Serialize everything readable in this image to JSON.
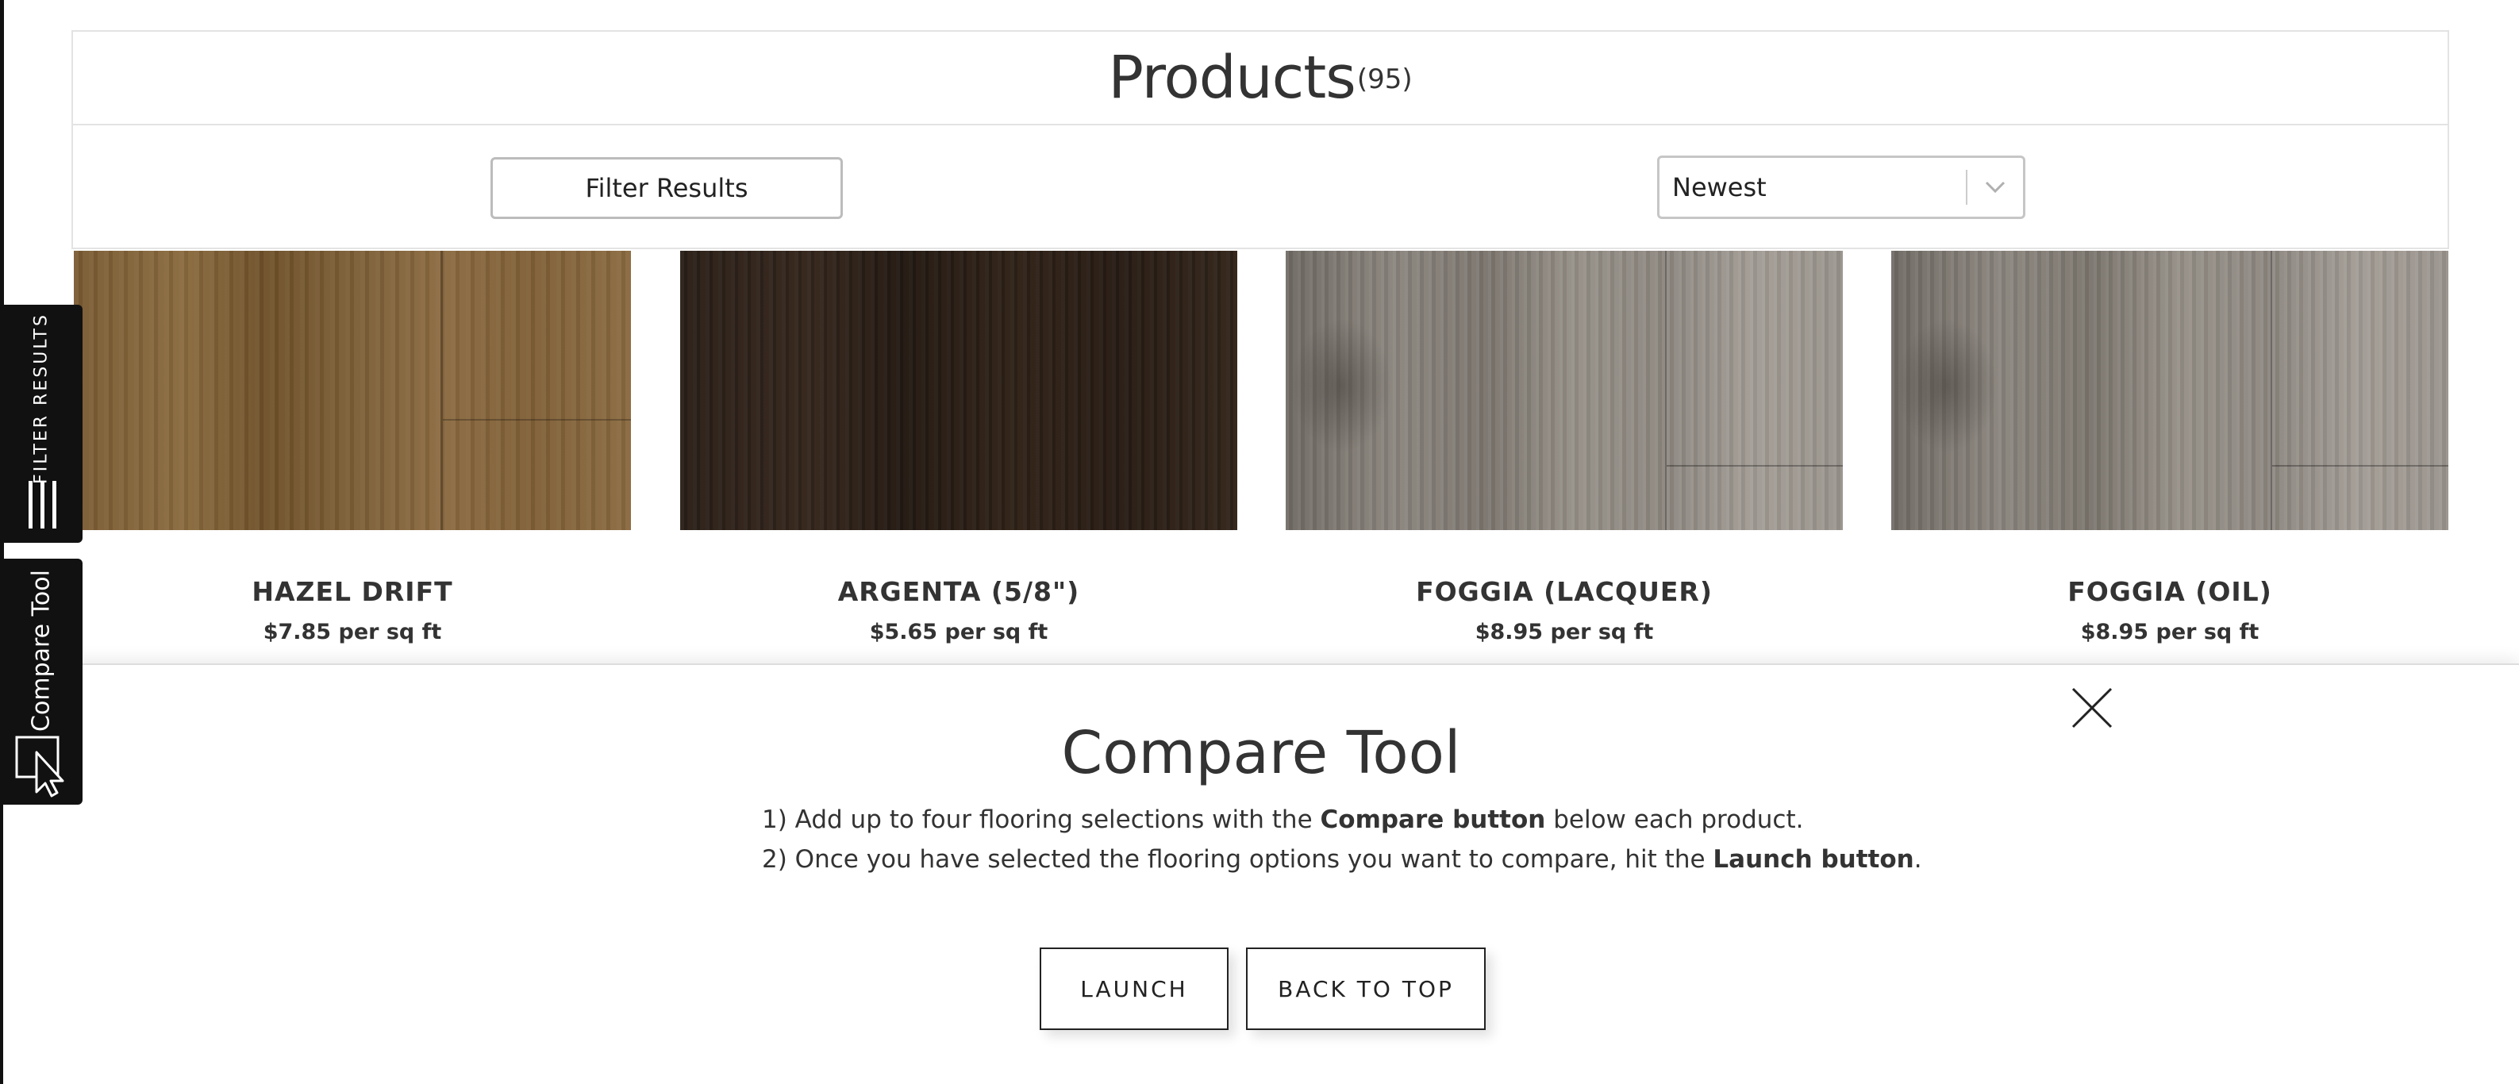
{
  "header": {
    "title": "Products",
    "count": "(95)"
  },
  "toolbar": {
    "filter_label": "Filter Results",
    "sort_value": "Newest"
  },
  "products": [
    {
      "name": "HAZEL DRIFT",
      "price": "$7.85 per sq ft"
    },
    {
      "name": "ARGENTA (5/8\")",
      "price": "$5.65 per sq ft"
    },
    {
      "name": "FOGGIA (LACQUER)",
      "price": "$8.95 per sq ft"
    },
    {
      "name": "FOGGIA (OIL)",
      "price": "$8.95 per sq ft"
    }
  ],
  "side_tabs": {
    "filter_label": "FILTER RESULTS",
    "compare_label": "Compare Tool"
  },
  "compare": {
    "title": "Compare Tool",
    "line1_pre": "1) Add up to four flooring selections with the ",
    "line1_bold": "Compare button",
    "line1_post": " below each product.",
    "line2_pre": "2) Once you have selected the flooring options you want to compare, hit the ",
    "line2_bold": "Launch button",
    "line2_post": ".",
    "launch_label": "LAUNCH",
    "back_to_top_label": "BACK TO TOP"
  },
  "icons": {
    "filter_tab_icon": "bars-icon",
    "compare_tab_icon": "cursor-select-icon",
    "close_icon": "close-icon",
    "sort_icon": "chevron-down-icon"
  }
}
